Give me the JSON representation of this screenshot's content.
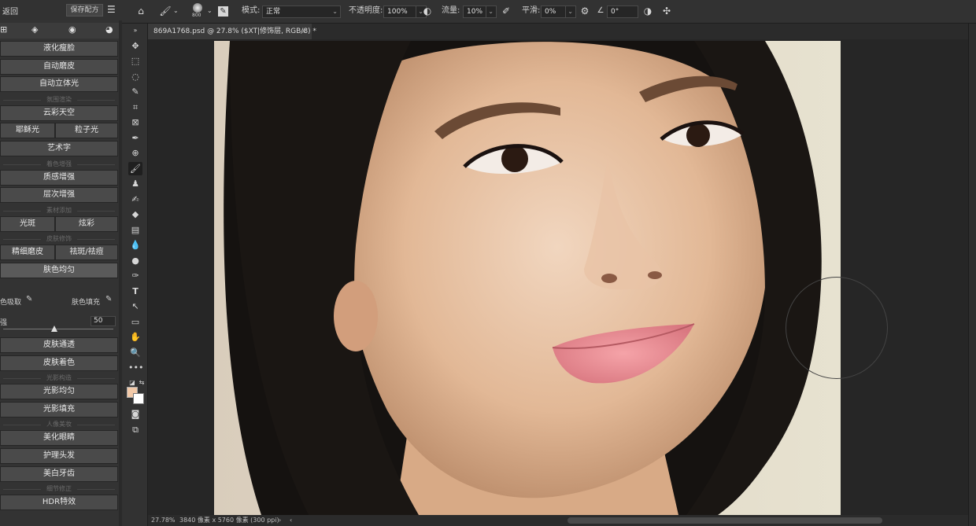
{
  "panel": {
    "back_label": "返回",
    "save_label": "保存配方",
    "rows": [
      {
        "type": "btn",
        "label": "液化瘦脸"
      },
      {
        "type": "btn",
        "label": "自动磨皮"
      },
      {
        "type": "btn",
        "label": "自动立体光"
      },
      {
        "type": "sec",
        "label": "氛围渲染"
      },
      {
        "type": "btn",
        "label": "云彩天空"
      },
      {
        "type": "pair",
        "labels": [
          "耶稣光",
          "粒子光"
        ]
      },
      {
        "type": "btn",
        "label": "艺术字"
      },
      {
        "type": "sec",
        "label": "着色增强"
      },
      {
        "type": "btn",
        "label": "质感增强"
      },
      {
        "type": "btn",
        "label": "层次增强"
      },
      {
        "type": "sec",
        "label": "素材添加"
      },
      {
        "type": "pair",
        "labels": [
          "光斑",
          "炫彩"
        ]
      },
      {
        "type": "sec",
        "label": "皮肤修饰"
      },
      {
        "type": "pair",
        "labels": [
          "精细磨皮",
          "祛斑/祛痘"
        ]
      },
      {
        "type": "btn",
        "label": "肤色均匀",
        "active": true
      }
    ],
    "color_pick_label": "色吸取",
    "color_fill_label": "肤色填充",
    "slider_label": "强",
    "slider_value": 50,
    "rows2": [
      {
        "type": "btn",
        "label": "皮肤通透"
      },
      {
        "type": "btn",
        "label": "皮肤着色"
      },
      {
        "type": "sec",
        "label": "光影构造"
      },
      {
        "type": "btn",
        "label": "光影均匀"
      },
      {
        "type": "btn",
        "label": "光影填充"
      },
      {
        "type": "sec",
        "label": "人像美妆"
      },
      {
        "type": "btn",
        "label": "美化眼睛"
      },
      {
        "type": "btn",
        "label": "护理头发"
      },
      {
        "type": "btn",
        "label": "美白牙齿"
      },
      {
        "type": "sec",
        "label": "细节修正"
      },
      {
        "type": "btn",
        "label": "HDR特效"
      }
    ]
  },
  "options": {
    "brush_size": "800",
    "mode_label": "模式:",
    "mode_value": "正常",
    "opacity_label": "不透明度:",
    "opacity_value": "100%",
    "flow_label": "流量:",
    "flow_value": "10%",
    "smooth_label": "平滑:",
    "smooth_value": "0%",
    "angle_value": "0°"
  },
  "document": {
    "tab_title": "869A1768.psd @ 27.8% ($XT|修饰层, RGB/8) *",
    "close": "×"
  },
  "status": {
    "zoom": "27.78%",
    "doc_info": "3840 像素 x 5760 像素 (300 ppi)",
    "arrow": "›",
    "arrow_left": "‹"
  },
  "colors": {
    "foreground": "#f2c9a8",
    "background": "#ffffff"
  }
}
